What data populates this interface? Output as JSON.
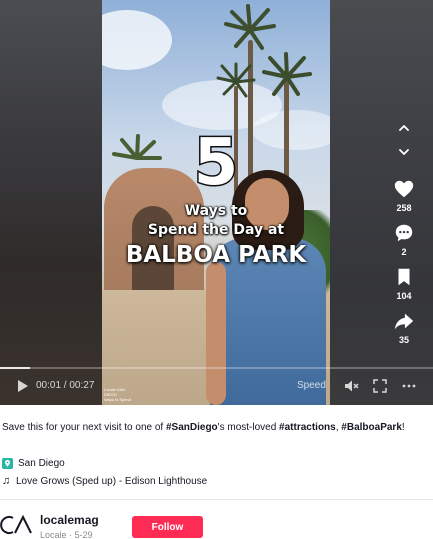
{
  "video": {
    "overlay": {
      "number": "5",
      "line1": "Ways to",
      "line2": "Spend the Day at",
      "line3": "BALBOA PARK"
    },
    "credit_lines": [
      "Locale SAN",
      "DIEGO",
      "Ways to Spend"
    ],
    "progress": 0.07
  },
  "actions": {
    "like": {
      "icon": "heart-icon",
      "count": "258"
    },
    "comment": {
      "icon": "comment-icon",
      "count": "2"
    },
    "save": {
      "icon": "bookmark-icon",
      "count": "104"
    },
    "share": {
      "icon": "share-icon",
      "count": "35"
    }
  },
  "player": {
    "time": "00:01 / 00:27",
    "speed_label": "Speed"
  },
  "post": {
    "caption_parts": [
      {
        "text": "Save this for your next visit to one of ",
        "bold": false
      },
      {
        "text": "#SanDiego",
        "bold": true
      },
      {
        "text": "'s most-loved ",
        "bold": false
      },
      {
        "text": "#attractions",
        "bold": true
      },
      {
        "text": ", ",
        "bold": false
      },
      {
        "text": "#BalboaPark",
        "bold": true
      },
      {
        "text": "!",
        "bold": false
      }
    ],
    "location": "San Diego",
    "music": "Love Grows (Sped up) - Edison Lighthouse"
  },
  "author": {
    "username": "localemag",
    "subline": "Locale · 5-29",
    "follow_label": "Follow"
  },
  "colors": {
    "follow": "#fe2c55",
    "location_icon": "#2ab5a4",
    "text": "#161823",
    "muted": "#8a8b91"
  }
}
